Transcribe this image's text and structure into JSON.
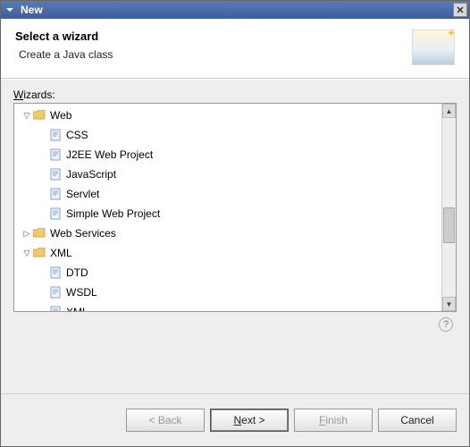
{
  "window": {
    "title": "New"
  },
  "banner": {
    "title": "Select a wizard",
    "subtitle": "Create a Java class"
  },
  "wizards_label_prefix": "W",
  "wizards_label_rest": "izards:",
  "tree": [
    {
      "depth": 0,
      "twisty": "down",
      "icon": "folder",
      "label": "Web"
    },
    {
      "depth": 1,
      "twisty": "none",
      "icon": "file",
      "label": "CSS"
    },
    {
      "depth": 1,
      "twisty": "none",
      "icon": "file",
      "label": "J2EE Web Project"
    },
    {
      "depth": 1,
      "twisty": "none",
      "icon": "file",
      "label": "JavaScript"
    },
    {
      "depth": 1,
      "twisty": "none",
      "icon": "file",
      "label": "Servlet"
    },
    {
      "depth": 1,
      "twisty": "none",
      "icon": "file",
      "label": "Simple Web Project"
    },
    {
      "depth": 0,
      "twisty": "right",
      "icon": "folder",
      "label": "Web Services"
    },
    {
      "depth": 0,
      "twisty": "down",
      "icon": "folder",
      "label": "XML"
    },
    {
      "depth": 1,
      "twisty": "none",
      "icon": "file",
      "label": "DTD"
    },
    {
      "depth": 1,
      "twisty": "none",
      "icon": "file",
      "label": "WSDL"
    },
    {
      "depth": 1,
      "twisty": "none",
      "icon": "file",
      "label": "XML"
    }
  ],
  "buttons": {
    "back": "< Back",
    "next_u": "N",
    "next_rest": "ext >",
    "finish_pre": "",
    "finish_u": "F",
    "finish_rest": "inish",
    "cancel": "Cancel"
  }
}
